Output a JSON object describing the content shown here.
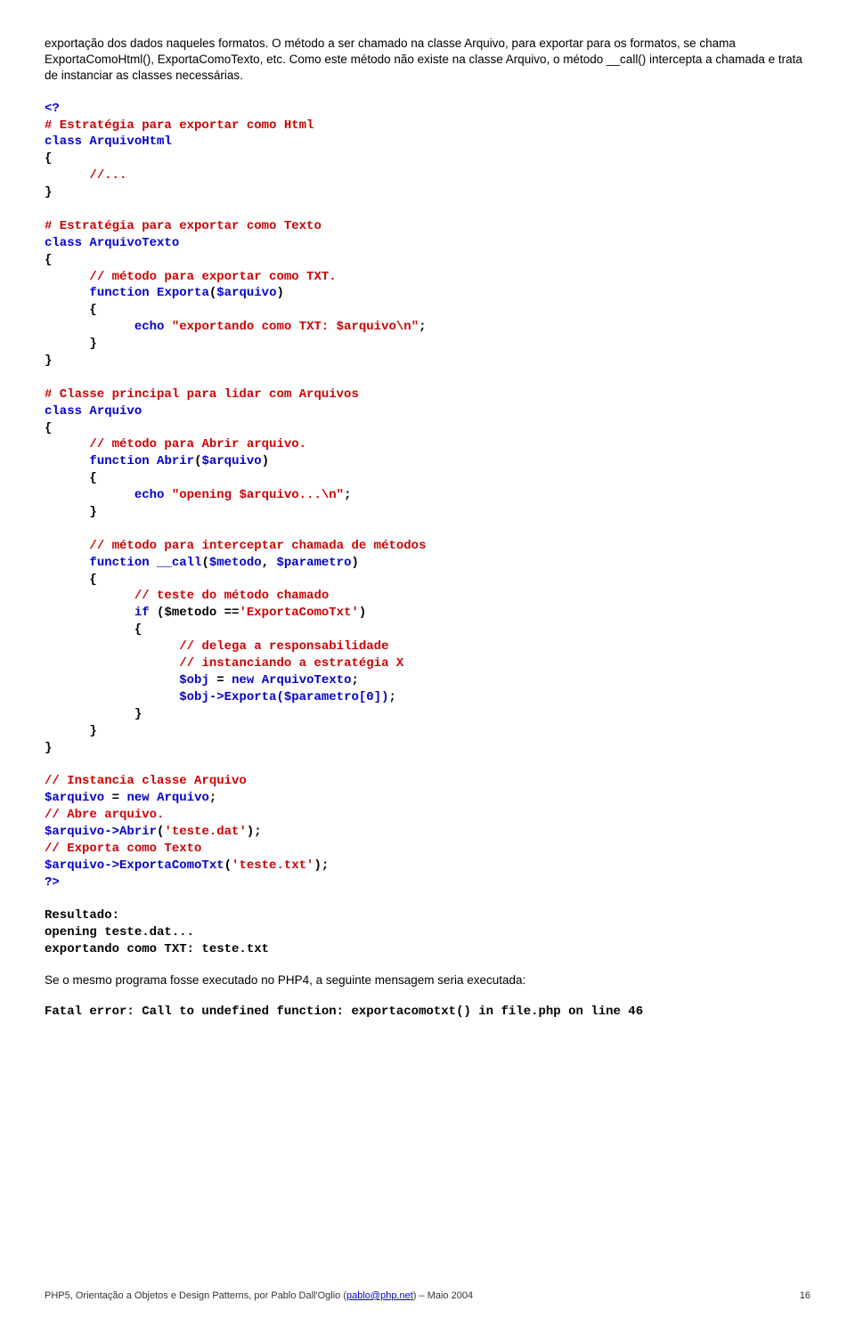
{
  "intro": "exportação dos dados naqueles formatos. O método a ser chamado na classe Arquivo, para exportar para os formatos, se chama ExportaComoHtml(), ExportaComoTexto, etc. Como este método não existe na classe Arquivo, o método __call() intercepta a chamada e trata de instanciar as classes necessárias.",
  "code": {
    "open_tag": "<?",
    "c1": "# Estratégia para exportar como Html",
    "class_kw": "class",
    "ArquivoHtml": "ArquivoHtml",
    "lbrace": "{",
    "rbrace": "}",
    "dots": "//...",
    "c2": "# Estratégia para exportar como Texto",
    "ArquivoTexto": "ArquivoTexto",
    "c3": "// método para exportar como TXT.",
    "function_kw": "function",
    "Exporta": "Exporta",
    "arg_arquivo": "$arquivo",
    "echo_kw": "echo",
    "str_export": "\"exportando como TXT: $arquivo\\n\"",
    "semi": ";",
    "c4": "# Classe principal para lidar com Arquivos",
    "Arquivo": "Arquivo",
    "c5": "// método para Abrir arquivo.",
    "Abrir": "Abrir",
    "str_open": "\"opening $arquivo...\\n\"",
    "c6": "// método para interceptar chamada de métodos",
    "call": "__call",
    "arg_metodo": "$metodo",
    "arg_param": "$parametro",
    "c7": "// teste do método chamado",
    "if_kw": "if",
    "cond_open": "($metodo ==",
    "cond_str": "'ExportaComoTxt'",
    "cond_close": ")",
    "c8": "// delega a responsabilidade",
    "c9": "// instanciando a estratégia X",
    "obj_assign": "$obj",
    "equals": "=",
    "new_kw": "new",
    "call_exporta": "$obj->Exporta($parametro[0])",
    "c10": "// Instancia classe Arquivo",
    "inst": "$arquivo",
    "c11": "// Abre arquivo.",
    "call_abrir": "$arquivo->Abrir",
    "lit_teste_dat": "'teste.dat'",
    "c12": "// Exporta como Texto",
    "call_export": "$arquivo->ExportaComoTxt",
    "lit_teste_txt": "'teste.txt'",
    "close_tag": "?>",
    "resultado_label": "Resultado:",
    "out1": "opening teste.dat...",
    "out2": "exportando como TXT: teste.txt"
  },
  "outro": "Se o mesmo programa fosse executado no PHP4, a seguinte mensagem seria executada:",
  "fatal": "Fatal error: Call to undefined function: exportacomotxt() in file.php on line 46",
  "footer": {
    "text_a": "PHP5, Orientação a Objetos e Design Patterns, por Pablo Dall'Oglio (",
    "email": "pablo@php.net",
    "text_b": ") – Maio 2004",
    "page": "16"
  }
}
